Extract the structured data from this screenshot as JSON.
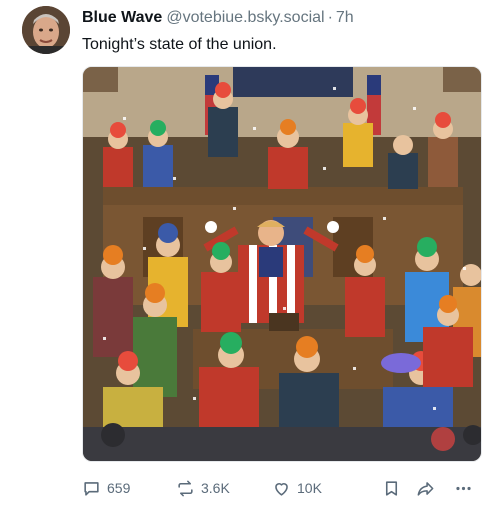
{
  "post": {
    "author": {
      "display_name": "Blue Wave",
      "handle": "@votebiue.bsky.social",
      "separator": "·",
      "time": "7h"
    },
    "text": "Tonight’s state of the union.",
    "image_icon": "photo-of-congress-chamber-full-of-clowns"
  },
  "actions": {
    "replies": "659",
    "reposts": "3.6K",
    "likes": "10K",
    "reply_icon": "speech-bubble-icon",
    "repost_icon": "repost-arrows-icon",
    "like_icon": "heart-icon",
    "bookmark_icon": "bookmark-icon",
    "share_icon": "share-arrow-icon",
    "more_icon": "ellipsis-icon"
  },
  "colors": {
    "text": "#0f1419",
    "muted": "#66757f",
    "action": "#5b6b7a"
  }
}
